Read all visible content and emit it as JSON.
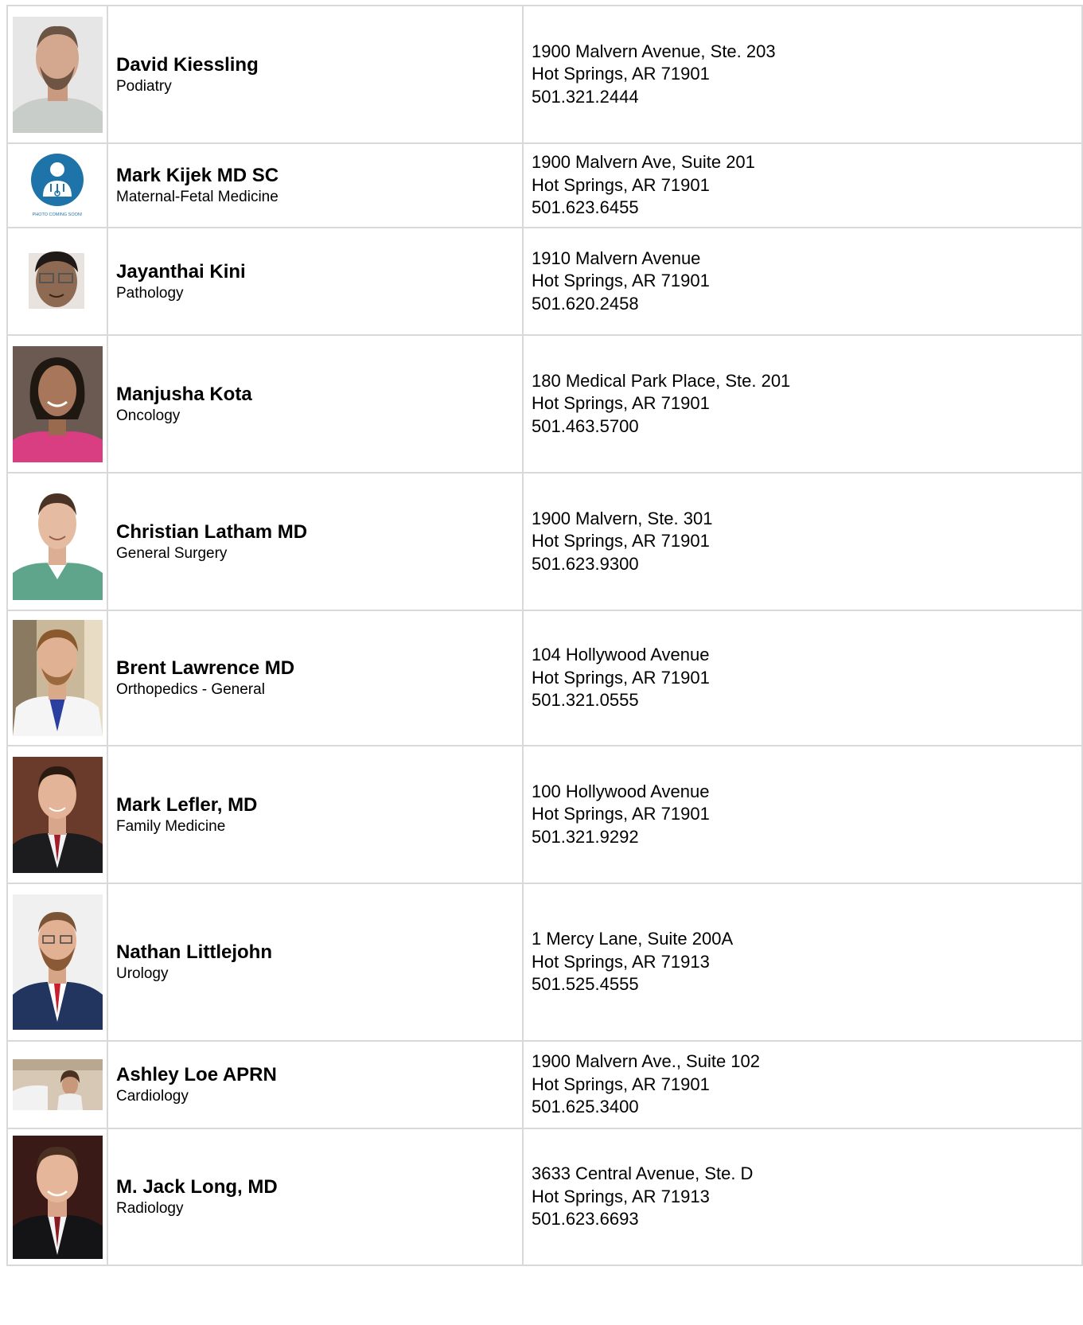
{
  "colors": {
    "border": "#d9d9d9",
    "placeholder_blue": "#1e73a8"
  },
  "physicians": [
    {
      "name": "David Kiessling",
      "specialty": "Podiatry",
      "address1": "1900 Malvern Avenue, Ste. 203",
      "address2": "Hot Springs, AR 71901",
      "phone": "501.321.2444",
      "photo_icon": "headshot-photo"
    },
    {
      "name": "Mark Kijek MD SC",
      "specialty": "Maternal-Fetal Medicine",
      "address1": "1900 Malvern Ave, Suite 201",
      "address2": "Hot Springs, AR 71901",
      "phone": "501.623.6455",
      "photo_icon": "doctor-placeholder-icon",
      "photo_caption": "PHOTO COMING SOON!"
    },
    {
      "name": "Jayanthai Kini",
      "specialty": "Pathology",
      "address1": "1910 Malvern Avenue",
      "address2": "Hot Springs, AR 71901",
      "phone": "501.620.2458",
      "photo_icon": "headshot-photo"
    },
    {
      "name": "Manjusha Kota",
      "specialty": "Oncology",
      "address1": "180 Medical Park Place, Ste. 201",
      "address2": "Hot Springs, AR 71901",
      "phone": "501.463.5700",
      "photo_icon": "headshot-photo"
    },
    {
      "name": "Christian Latham MD",
      "specialty": "General Surgery",
      "address1": "1900 Malvern, Ste. 301",
      "address2": "Hot Springs, AR 71901",
      "phone": "501.623.9300",
      "photo_icon": "headshot-photo"
    },
    {
      "name": "Brent Lawrence MD",
      "specialty": "Orthopedics - General",
      "address1": "104 Hollywood Avenue",
      "address2": "Hot Springs, AR 71901",
      "phone": "501.321.0555",
      "photo_icon": "headshot-photo"
    },
    {
      "name": "Mark Lefler, MD",
      "specialty": "Family Medicine",
      "address1": "100 Hollywood Avenue",
      "address2": "Hot Springs, AR 71901",
      "phone": "501.321.9292",
      "photo_icon": "headshot-photo"
    },
    {
      "name": "Nathan Littlejohn",
      "specialty": "Urology",
      "address1": "1 Mercy Lane, Suite 200A",
      "address2": "Hot Springs, AR 71913",
      "phone": "501.525.4555",
      "photo_icon": "headshot-photo"
    },
    {
      "name": "Ashley Loe APRN",
      "specialty": "Cardiology",
      "address1": "1900 Malvern Ave., Suite 102",
      "address2": "Hot Springs, AR 71901",
      "phone": "501.625.3400",
      "photo_icon": "headshot-photo"
    },
    {
      "name": "M. Jack Long, MD",
      "specialty": "Radiology",
      "address1": "3633 Central Avenue, Ste. D",
      "address2": "Hot Springs, AR 71913",
      "phone": "501.623.6693",
      "photo_icon": "headshot-photo"
    }
  ]
}
